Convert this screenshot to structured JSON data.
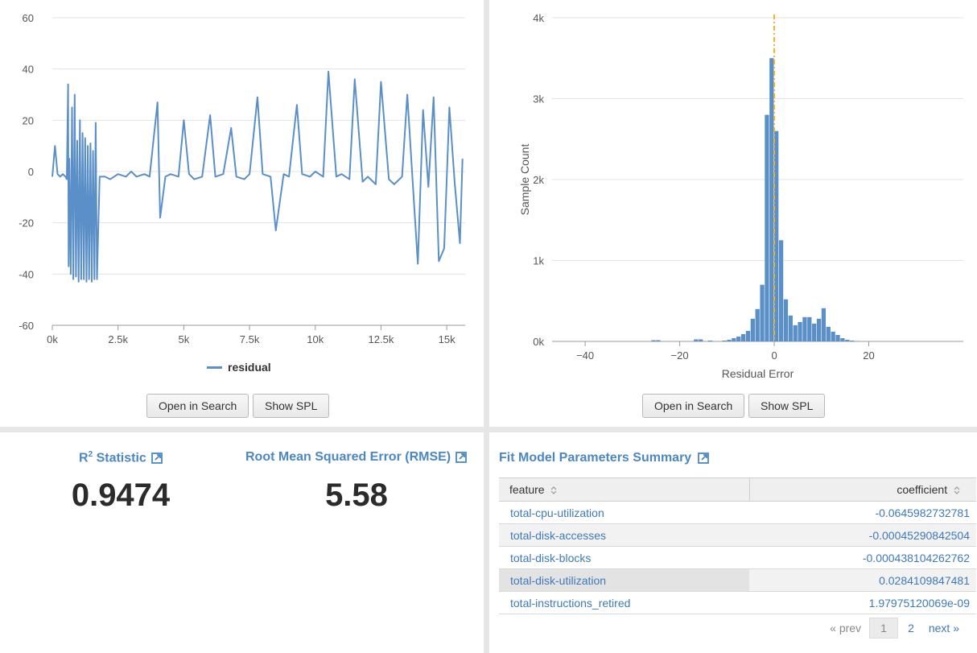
{
  "residual_panel": {
    "legend_label": "residual",
    "buttons": {
      "open_search": "Open in Search",
      "show_spl": "Show SPL"
    }
  },
  "histogram_panel": {
    "buttons": {
      "open_search": "Open in Search",
      "show_spl": "Show SPL"
    }
  },
  "chart_data": [
    {
      "type": "line",
      "series": [
        {
          "name": "residual",
          "x": [
            0,
            100,
            200,
            300,
            400,
            500,
            550,
            600,
            620,
            650,
            700,
            750,
            800,
            850,
            900,
            950,
            1000,
            1050,
            1100,
            1150,
            1200,
            1250,
            1300,
            1350,
            1400,
            1450,
            1500,
            1550,
            1600,
            1650,
            1700,
            1800,
            2000,
            2200,
            2500,
            2800,
            3000,
            3200,
            3500,
            3700,
            4000,
            4100,
            4300,
            4500,
            4800,
            5000,
            5200,
            5400,
            5700,
            6000,
            6200,
            6500,
            6800,
            7000,
            7300,
            7500,
            7800,
            8000,
            8300,
            8500,
            8800,
            9000,
            9300,
            9500,
            9800,
            10000,
            10300,
            10500,
            10800,
            11000,
            11300,
            11500,
            11800,
            12000,
            12300,
            12500,
            12800,
            13000,
            13300,
            13500,
            13700,
            13900,
            14100,
            14300,
            14500,
            14700,
            14900,
            15100,
            15300,
            15500,
            15600
          ],
          "values": [
            -2,
            10,
            -1,
            -2,
            -1,
            -2,
            -3,
            34,
            -37,
            5,
            -40,
            25,
            -42,
            30,
            -41,
            12,
            -43,
            20,
            -42,
            15,
            -42,
            13,
            -43,
            10,
            -42,
            11,
            -43,
            8,
            -42,
            19,
            -42,
            -2,
            -2,
            -3,
            -1,
            -2,
            0,
            -2,
            -1,
            -2,
            27,
            -18,
            -2,
            -1,
            -2,
            20,
            -1,
            -3,
            -2,
            22,
            -2,
            -1,
            17,
            -2,
            -3,
            -1,
            29,
            -1,
            -2,
            -23,
            -1,
            -2,
            26,
            -1,
            -2,
            0,
            -2,
            39,
            -2,
            -1,
            -3,
            36,
            -4,
            -2,
            -5,
            35,
            -3,
            -5,
            -2,
            30,
            -3,
            -36,
            24,
            -6,
            29,
            -35,
            -30,
            25,
            -4,
            -28,
            5
          ]
        }
      ],
      "xticks": [
        "0k",
        "2.5k",
        "5k",
        "7.5k",
        "10k",
        "12.5k",
        "15k"
      ],
      "yticks": [
        "-60",
        "-40",
        "-20",
        "0",
        "20",
        "40",
        "60"
      ],
      "xlim": [
        0,
        15700
      ],
      "ylim": [
        -60,
        60
      ]
    },
    {
      "type": "bar",
      "xlabel": "Residual Error",
      "ylabel": "Sample Count",
      "xticks": [
        "−40",
        "−20",
        "0",
        "20"
      ],
      "yticks": [
        "0k",
        "1k",
        "2k",
        "3k",
        "4k"
      ],
      "xlim": [
        -47,
        40
      ],
      "ylim": [
        0,
        4000
      ],
      "bin_width": 1,
      "bins": [
        -26,
        -25,
        -17,
        -16,
        -14,
        -11,
        -10,
        -9,
        -8,
        -7,
        -6,
        -5,
        -4,
        -3,
        -2,
        -1,
        0,
        1,
        2,
        3,
        4,
        5,
        6,
        7,
        8,
        9,
        10,
        11,
        12,
        13,
        14,
        15,
        16,
        17
      ],
      "values": [
        15,
        15,
        25,
        25,
        10,
        10,
        20,
        40,
        60,
        90,
        130,
        280,
        400,
        700,
        2800,
        3500,
        2600,
        1250,
        520,
        320,
        200,
        240,
        300,
        300,
        220,
        280,
        410,
        180,
        120,
        80,
        40,
        20,
        10,
        5
      ],
      "reference_line": 0
    }
  ],
  "r2": {
    "title_prefix": "R",
    "title_sup": "2",
    "title_suffix": " Statistic",
    "value": "0.9474"
  },
  "rmse": {
    "title": "Root Mean Squared Error (RMSE)",
    "value": "5.58"
  },
  "params": {
    "title": "Fit Model Parameters Summary",
    "columns": [
      "feature",
      "coefficient"
    ],
    "rows": [
      {
        "feature": "total-cpu-utilization",
        "coefficient": "-0.0645982732781"
      },
      {
        "feature": "total-disk-accesses",
        "coefficient": "-0.00045290842504"
      },
      {
        "feature": "total-disk-blocks",
        "coefficient": "-0.000438104262762"
      },
      {
        "feature": "total-disk-utilization",
        "coefficient": "0.0284109847481"
      },
      {
        "feature": "total-instructions_retired",
        "coefficient": "1.97975120069e-09"
      }
    ],
    "pager": {
      "prev": "« prev",
      "current": "1",
      "page2": "2",
      "next": "next »"
    }
  },
  "colors": {
    "series": "#5b8fc7",
    "reference": "#f0b429",
    "link": "#4b88c2"
  }
}
